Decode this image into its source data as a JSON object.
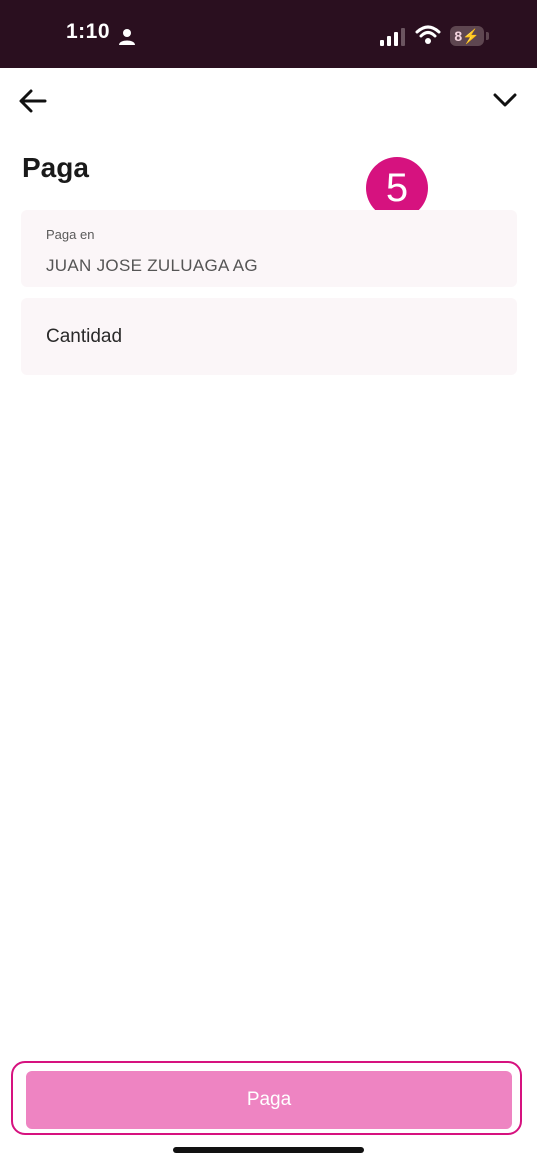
{
  "status_bar": {
    "time": "1:10",
    "battery": "8",
    "icons": [
      "person-icon",
      "signal-icon",
      "wifi-icon",
      "battery-icon"
    ]
  },
  "nav": {
    "back_icon": "arrow-left",
    "collapse_icon": "chevron-down"
  },
  "page": {
    "title": "Paga",
    "step_badge": "5"
  },
  "form": {
    "payee_label": "Paga en",
    "payee_value": "JUAN JOSE ZULUAGA AG",
    "amount_placeholder": "Cantidad",
    "amount_value": ""
  },
  "footer": {
    "pay_button_label": "Paga"
  },
  "colors": {
    "status_bar_bg": "#2a0f1f",
    "accent": "#d6127f",
    "button_bg": "#ee84c2",
    "field_bg": "#fbf6f8"
  }
}
